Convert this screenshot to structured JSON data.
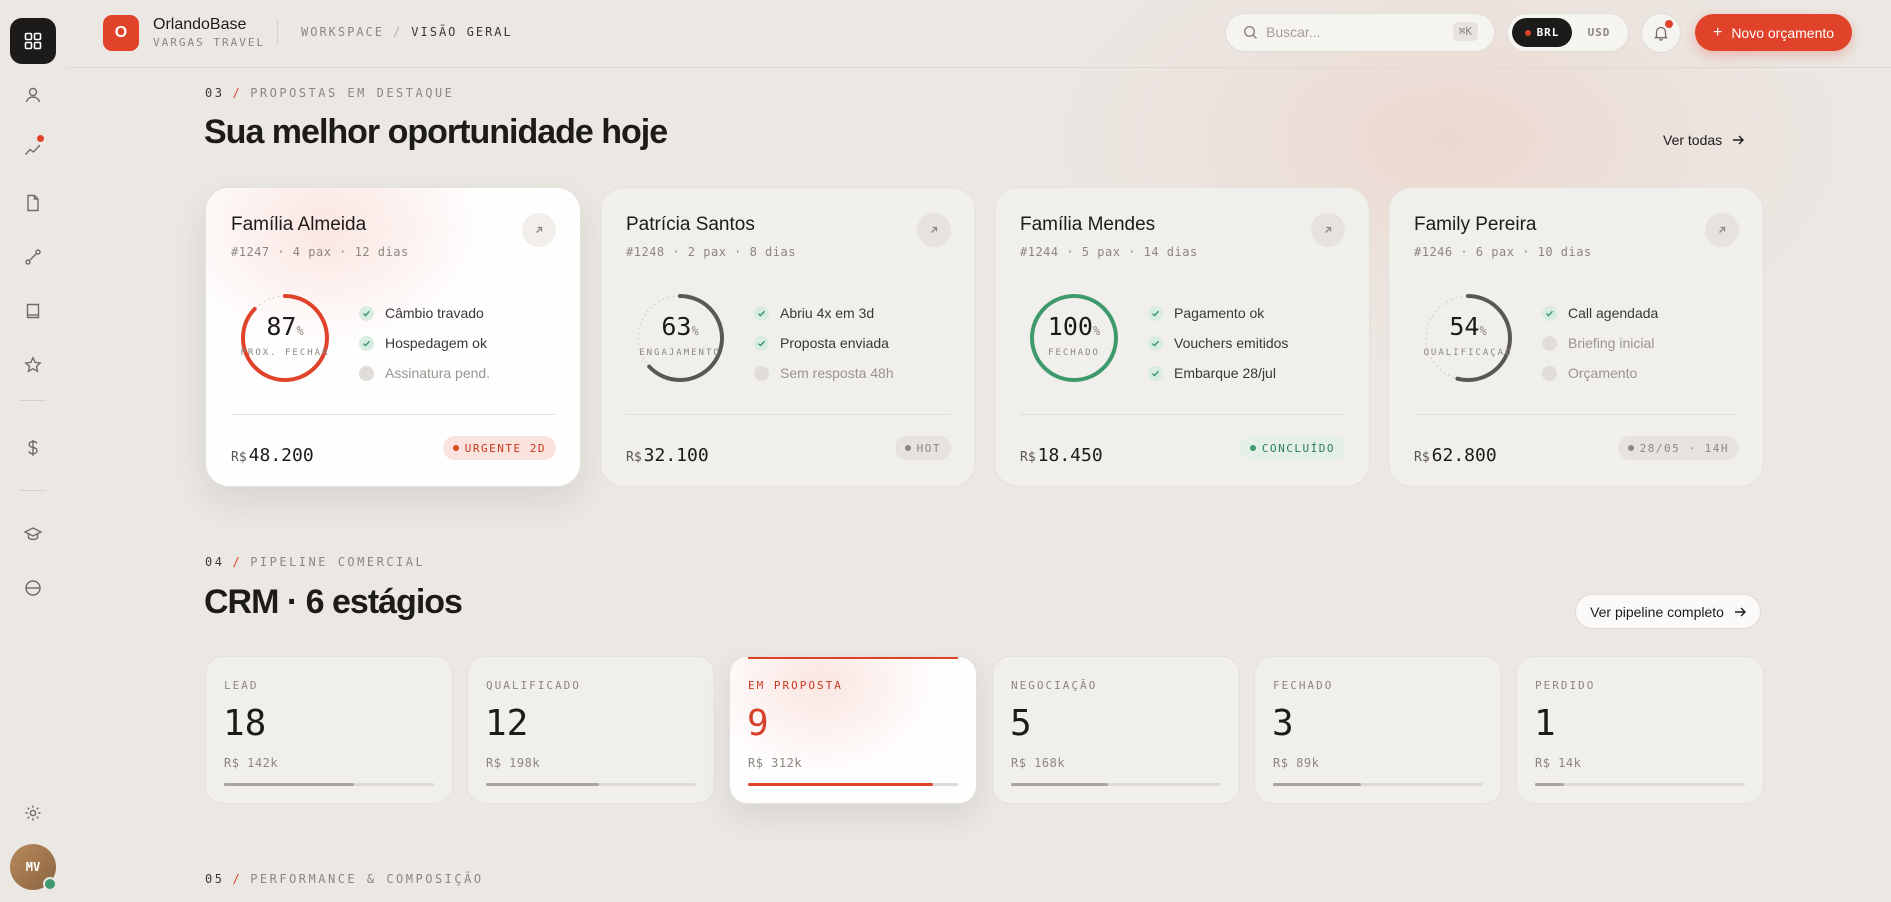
{
  "app": {
    "name": "OrlandoBase",
    "subtitle": "VARGAS TRAVEL",
    "logo_letter": "O"
  },
  "breadcrumb": {
    "root": "WORKSPACE",
    "separator": "/",
    "current": "VISÃO GERAL"
  },
  "search": {
    "placeholder": "Buscar...",
    "shortcut": "⌘K"
  },
  "currency": {
    "options": [
      "BRL",
      "USD"
    ],
    "selected": "BRL"
  },
  "header": {
    "new_button": "Novo orçamento"
  },
  "user": {
    "initials": "MV"
  },
  "sidebar": {
    "icons": [
      "grid-icon",
      "user-icon",
      "trend-icon",
      "document-icon",
      "route-icon",
      "book-icon",
      "star-icon",
      "dollar-icon",
      "graduation-cap-icon",
      "globe-icon",
      "settings-icon"
    ],
    "active": "grid-icon"
  },
  "featured": {
    "section_number": "03",
    "section_label": "PROPOSTAS EM DESTAQUE",
    "title": "Sua melhor oportunidade hoje",
    "view_all": "Ver todas",
    "cards": [
      {
        "name": "Família Almeida",
        "meta": "#1247 · 4 pax · 12 dias",
        "percent": "87",
        "percent_value": 87,
        "ring_label": "PRÓX. FECHAR",
        "checks": [
          {
            "label": "Câmbio travado",
            "done": true
          },
          {
            "label": "Hospedagem ok",
            "done": true
          },
          {
            "label": "Assinatura pend.",
            "done": false
          }
        ],
        "currency": "R$",
        "price": "48.200",
        "badge": "URGENTE 2D",
        "badge_type": "urgent",
        "ring_color": "#e0432a"
      },
      {
        "name": "Patrícia Santos",
        "meta": "#1248 · 2 pax · 8 dias",
        "percent": "63",
        "percent_value": 63,
        "ring_label": "ENGAJAMENTO",
        "checks": [
          {
            "label": "Abriu 4x em 3d",
            "done": true
          },
          {
            "label": "Proposta enviada",
            "done": true
          },
          {
            "label": "Sem resposta 48h",
            "done": false
          }
        ],
        "currency": "R$",
        "price": "32.100",
        "badge": "HOT",
        "badge_type": "hot",
        "ring_color": "#5a5855"
      },
      {
        "name": "Família Mendes",
        "meta": "#1244 · 5 pax · 14 dias",
        "percent": "100",
        "percent_value": 100,
        "ring_label": "FECHADO",
        "checks": [
          {
            "label": "Pagamento ok",
            "done": true
          },
          {
            "label": "Vouchers emitidos",
            "done": true
          },
          {
            "label": "Embarque 28/jul",
            "done": true
          }
        ],
        "currency": "R$",
        "price": "18.450",
        "badge": "CONCLUÍDO",
        "badge_type": "done",
        "ring_color": "#3e9a6c"
      },
      {
        "name": "Family Pereira",
        "meta": "#1246 · 6 pax · 10 dias",
        "percent": "54",
        "percent_value": 54,
        "ring_label": "QUALIFICAÇÃO",
        "checks": [
          {
            "label": "Call agendada",
            "done": true
          },
          {
            "label": "Briefing inicial",
            "done": false
          },
          {
            "label": "Orçamento",
            "done": false
          }
        ],
        "currency": "R$",
        "price": "62.800",
        "badge": "28/05 · 14H",
        "badge_type": "date",
        "ring_color": "#5a5855"
      }
    ]
  },
  "pipeline": {
    "section_number": "04",
    "section_label": "PIPELINE COMERCIAL",
    "title": "CRM · 6 estágios",
    "view_link": "Ver pipeline completo",
    "stages": [
      {
        "label": "LEAD",
        "count": "18",
        "amount": "R$ 142k",
        "progress": 0.62,
        "active": false
      },
      {
        "label": "QUALIFICADO",
        "count": "12",
        "amount": "R$ 198k",
        "progress": 0.54,
        "active": false
      },
      {
        "label": "EM PROPOSTA",
        "count": "9",
        "amount": "R$ 312k",
        "progress": 0.88,
        "active": true
      },
      {
        "label": "NEGOCIAÇÃO",
        "count": "5",
        "amount": "R$ 168k",
        "progress": 0.46,
        "active": false
      },
      {
        "label": "FECHADO",
        "count": "3",
        "amount": "R$ 89k",
        "progress": 0.42,
        "active": false
      },
      {
        "label": "PERDIDO",
        "count": "1",
        "amount": "R$ 14k",
        "progress": 0.14,
        "active": false
      }
    ]
  },
  "next_section": {
    "section_number": "05",
    "section_label": "PERFORMANCE & COMPOSIÇÃO"
  }
}
